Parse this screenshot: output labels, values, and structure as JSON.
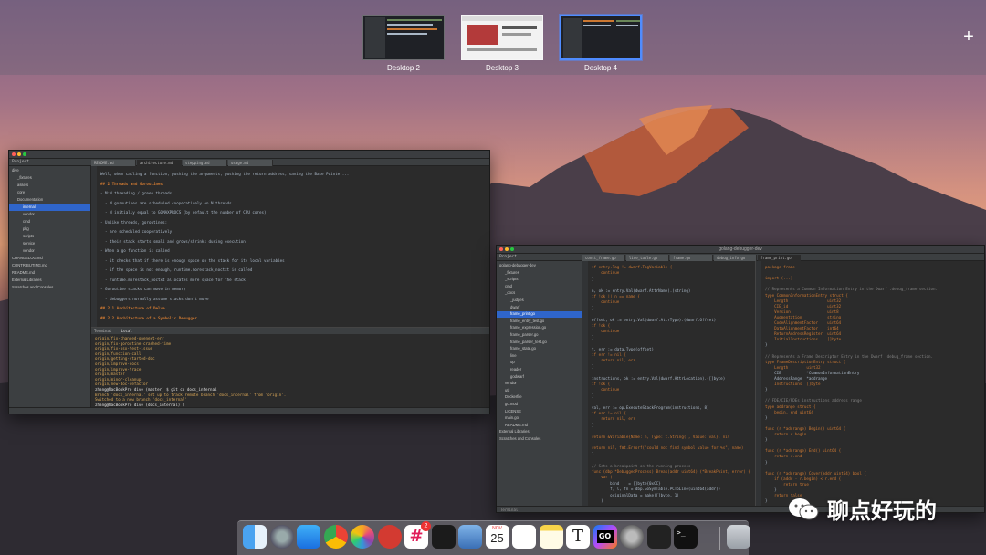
{
  "spaces": {
    "desktops": [
      {
        "label": "Desktop 2"
      },
      {
        "label": "Desktop 3"
      },
      {
        "label": "Desktop 4",
        "active": true
      }
    ],
    "add_label": "+"
  },
  "left_window": {
    "project_label": "Project",
    "project_root": "dive",
    "tree_items": [
      "dive",
      "_fixtures",
      "assets",
      "core",
      "Documentation",
      "internal",
      "vendor",
      "cmd",
      "pkg",
      "scripts",
      "service",
      "vendor",
      "CHANGELOG.md",
      "CONTRIBUTING.md",
      "README.md",
      "External Libraries",
      "Scratches and Consoles"
    ],
    "tabs": [
      "README.md",
      "architecture.md",
      "stepping.md",
      "usage.md"
    ],
    "heading": "## 2 Threads and Goroutines",
    "lines": [
      "Well, when calling a function, pushing the arguments, pushing the return address, saving the Base Pointer...",
      "## 2 Threads and Goroutines",
      "- M:N threading / green threads",
      "  - M goroutines are scheduled cooperatively on N threads",
      "  - N initially equal to GOMAXPROCS (by default the number of CPU cores)",
      "- Unlike threads, goroutines:",
      "  - are scheduled cooperatively",
      "  - their stack starts small and grows/shrinks during execution",
      "- When a go function is called",
      "  - it checks that if there is enough space on the stack for its local variables",
      "  - if the space is not enough, runtime.morestack_noctxt is called",
      "  - runtime.morestack_noctxt allocates more space for the stack",
      "- Goroutine stacks can move in memory",
      "  - debuggers normally assume stacks don't move",
      "## 2.1 Architecture of Delve",
      "## 2.2 Architecture of a Symbolic Debugger"
    ],
    "terminal_label": "Terminal",
    "terminal_tab": "Local",
    "terminal_lines": [
      "origin/fix-changed-onenext-err",
      "origin/fix-goroutine-crashed-time",
      "origin/fix-osx-test-issue",
      "origin/function-call",
      "origin/getting-started-doc",
      "origin/improve-docs",
      "origin/improve-trace",
      "origin/master",
      "origin/minor-cleanup",
      "origin/new-doc-refactor",
      "zhang@MacBookPro dive (master) $ git co docs_internal",
      "Branch 'docs_internal' set up to track remote branch 'docs_internal' from 'origin'.",
      "Switched to a new branch 'docs_internal'",
      "zhang@MacBookPro dive (docs_internal) $"
    ]
  },
  "right_window": {
    "title": "golang-debugger-dev",
    "project_label": "Project",
    "tree_items": [
      "golang-debugger-dev",
      "_fixtures",
      "_scripts",
      "cmd",
      "_docs",
      "_judges",
      "dwarf",
      "frame_print.go",
      "frame_entry_test.go",
      "frame_expression.go",
      "frame_parser.go",
      "frame_parser_test.go",
      "frame_state.go",
      "line",
      "op",
      "reader",
      "godwarf",
      "vendor",
      "util",
      "Dockerfile",
      "go.mod",
      "LICENSE",
      "main.go",
      "README.md",
      "External Libraries",
      "Scratches and Consoles"
    ],
    "tabs": [
      "const_frame.go",
      "line_table.go",
      "frame.go",
      "debug_info.go",
      "frame_print.go"
    ],
    "code_lines": [
      "if entry.Tag != dwarf.TagVariable {",
      "    continue",
      "}",
      "",
      "n, ok := entry.Val(dwarf.AttrName).(string)",
      "if !ok || n == name {",
      "    continue",
      "}",
      "",
      "offset, ok := entry.Val(dwarf.AttrType).(dwarf.Offset)",
      "if !ok {",
      "    continue",
      "}",
      "",
      "t, err := data.Type(offset)",
      "if err != nil {",
      "    return nil, err",
      "}",
      "",
      "instructions, ok := entry.Val(dwarf.AttrLocation).([]byte)",
      "if !ok {",
      "    continue",
      "}",
      "",
      "val, err := op.ExecuteStackProgram(instructions, 8)",
      "if err != nil {",
      "    return nil, err",
      "}",
      "",
      "return &Variable{Name: n, Type: t.String(), Value: val}, nil",
      "",
      "return nil, fmt.Errorf(\"could not find symbol value for %s\", name)",
      "}",
      "",
      "// Sets a breakpoint on the running process",
      "func (dbp *DebuggedProcess) Break(addr uint64) (*BreakPoint, error) {",
      "    var (",
      "        bind    = []byte{0xCC}",
      "        f, l, fn = dbp.GoSymTable.PCToLine(uint64(addr))",
      "        originalData = make([]byte, 1)",
      "    )"
    ],
    "side_lines": [
      "package frame",
      "",
      "import (...)",
      "",
      "// Represents a Common Information Entry in the Dwarf .debug_frame section.",
      "type CommonInformationEntry struct {",
      "    Length                 uint32",
      "    CIE_id                 uint32",
      "    Version                uint8",
      "    Augmentation           string",
      "    CodeAlignmentFactor    uint64",
      "    DataAlignmentFactor    int64",
      "    ReturnAddressRegister  uint64",
      "    InitialInstructions    []byte",
      "}",
      "",
      "// Represents a Frame Descriptor Entry in the Dwarf .debug_frame section.",
      "type FrameDescriptionEntry struct {",
      "    Length        uint32",
      "    CIE           *CommonInformationEntry",
      "    AddressRange  *addrange",
      "    Instructions  []byte",
      "}",
      "",
      "// FDE/CIE/FDEs instructions address range",
      "type addrange struct {",
      "    begin, end uint64",
      "}",
      "",
      "func (r *addrange) Begin() uint64 {",
      "    return r.begin",
      "}",
      "",
      "func (r *addrange) End() uint64 {",
      "    return r.end",
      "}",
      "",
      "func (r *addrange) Cover(addr uint64) bool {",
      "    if (addr - r.begin) < r.end {",
      "        return true",
      "    }",
      "    return false",
      "}"
    ],
    "terminal_label": "Terminal"
  },
  "dock": {
    "apps": [
      "finder-icon",
      "launchpad-icon",
      "app-store-icon",
      "chrome-icon",
      "photos-icon",
      "netease-music-icon",
      "slack-icon",
      "activity-monitor-icon",
      "preview-icon",
      "calendar-icon",
      "reminders-icon",
      "notes-icon",
      "typora-icon",
      "goland-icon",
      "system-preferences-icon",
      "console-icon",
      "terminal-icon",
      "trash-icon"
    ],
    "calendar_day": "25",
    "calendar_month": "NOV",
    "slack_badge": "2"
  },
  "watermark": {
    "text": "聊点好玩的"
  },
  "colors": {
    "accent": "#4f8cff",
    "ide_bg": "#2b2b2b",
    "ide_panel": "#3c3f41",
    "selection": "#2f65ca"
  }
}
